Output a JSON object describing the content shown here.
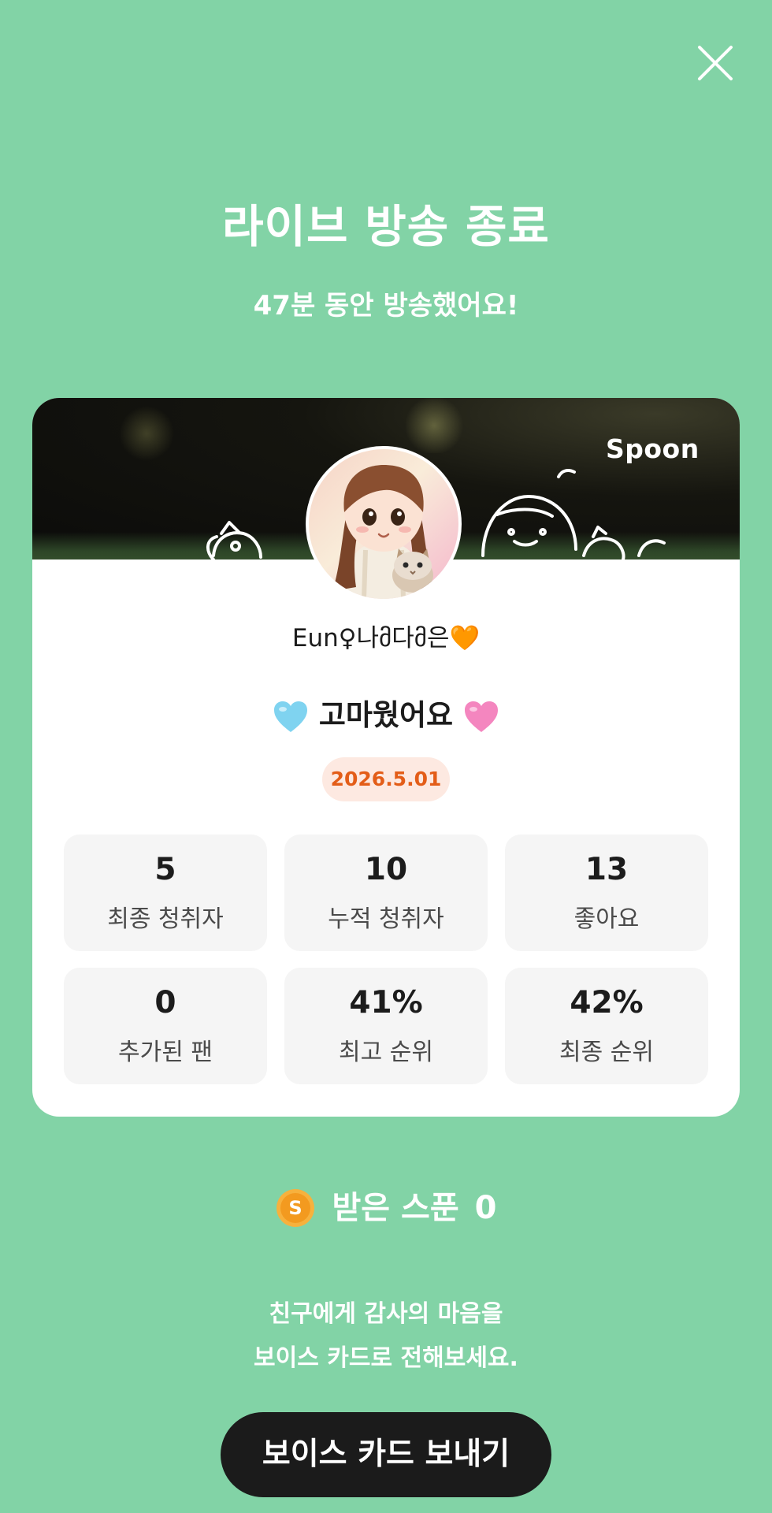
{
  "header": {
    "title": "라이브 방송 종료",
    "subtitle": "47분 동안 방송했어요!"
  },
  "card": {
    "brand": "Spoon",
    "nickname": "Eun♀나მ다მ은🧡",
    "message": "고마웠어요",
    "date": "2026.5.01",
    "stats": [
      {
        "value": "5",
        "label": "최종 청취자"
      },
      {
        "value": "10",
        "label": "누적 청취자"
      },
      {
        "value": "13",
        "label": "좋아요"
      },
      {
        "value": "0",
        "label": "추가된 팬"
      },
      {
        "value": "41%",
        "label": "최고 순위"
      },
      {
        "value": "42%",
        "label": "최종 순위"
      }
    ]
  },
  "spoons": {
    "label": "받은 스푼",
    "count": "0",
    "coin_letter": "S"
  },
  "footer": {
    "line1": "친구에게 감사의 마음을",
    "line2": "보이스 카드로 전해보세요.",
    "button_label": "보이스 카드 보내기"
  },
  "colors": {
    "background": "#82d3a6",
    "card": "#ffffff",
    "badge_bg": "#fde9e1",
    "badge_text": "#e35d18",
    "button": "#1b1b1b"
  },
  "icons": {
    "close": "close-icon",
    "heart_left": "light-blue-heart-icon",
    "heart_right": "pink-heart-icon",
    "coin": "spoon-coin-icon"
  }
}
